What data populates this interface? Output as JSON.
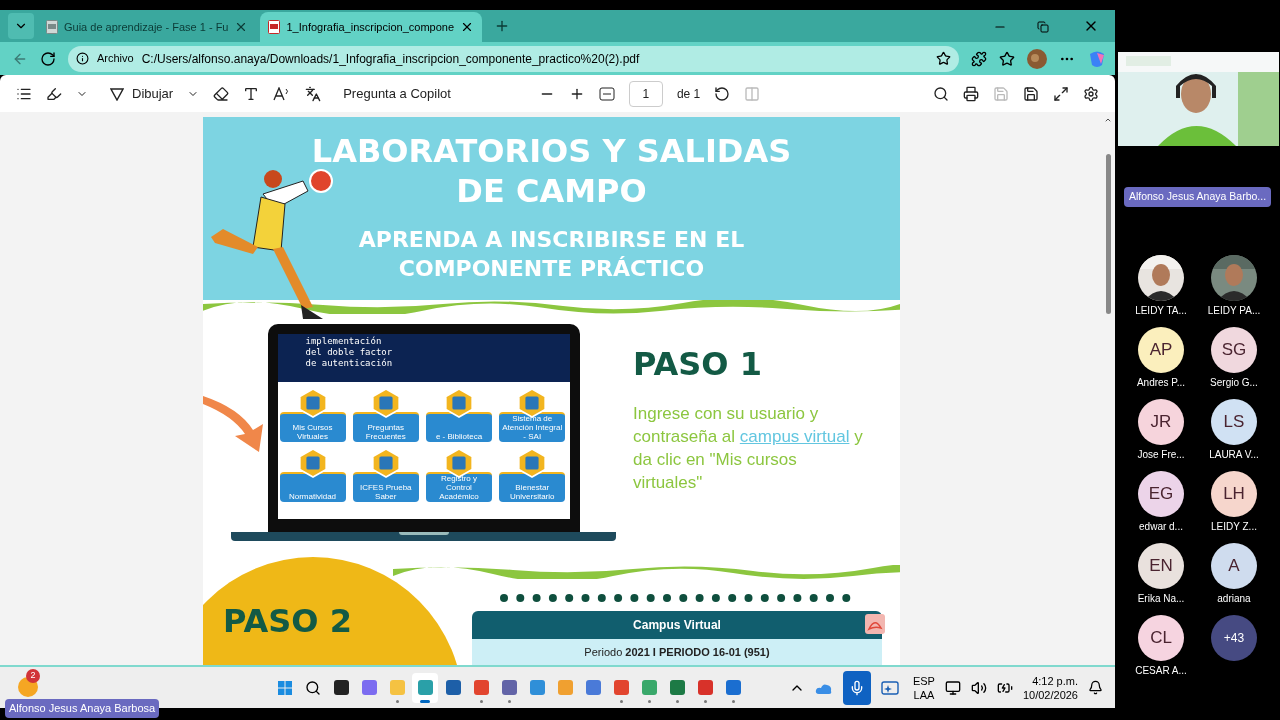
{
  "browser": {
    "tabs": [
      {
        "title": "Guia de aprendizaje - Fase 1 - Fu",
        "selected": false
      },
      {
        "title": "1_Infografia_inscripcion_compone",
        "selected": true
      }
    ],
    "address": {
      "prefix": "Archivo",
      "url": "C:/Users/alfonso.anaya/Downloads/1_Infografia_inscripcion_componente_practico%20(2).pdf"
    }
  },
  "pdf_toolbar": {
    "draw_label": "Dibujar",
    "copilot": "Pregunta a Copilot",
    "page": "1",
    "page_total": "de 1"
  },
  "document": {
    "title_lines": [
      "LABORATORIOS Y SALIDAS",
      "DE CAMPO"
    ],
    "subtitle_lines": [
      "APRENDA A INSCRIBIRSE EN EL",
      "COMPONENTE PRÁCTICO"
    ],
    "laptop": {
      "banner_lines": [
        "implementación",
        "del doble factor",
        "de autenticación"
      ],
      "tiles": [
        "Mis Cursos Virtuales",
        "Preguntas Frecuentes",
        "e - Biblioteca",
        "Sistema de Atención Integral - SAI",
        "Normatividad",
        "ICFES Prueba Saber",
        "Registro y Control Académico",
        "Bienestar Universitario"
      ]
    },
    "step1": {
      "heading": "PASO 1",
      "text_before": "Ingrese con su usuario y contraseña al",
      "link": "campus virtual",
      "text_after": "y da clic en \"Mis cursos virtuales\""
    },
    "step2": {
      "heading": "PASO 2",
      "panel_title": "Campus Virtual",
      "period": "Periodo **2021 I PERIODO 16-01 (951)**"
    }
  },
  "meeting": {
    "presenter_label": "Alfonso Jesus Anaya Barbo...",
    "participants": [
      {
        "name": "LEIDY TA..."
      },
      {
        "name": "LEIDY PA..."
      },
      {
        "kind": "initials",
        "initials": "AP",
        "name": "Andres P...",
        "color": "#fbefbd"
      },
      {
        "kind": "initials",
        "initials": "SG",
        "name": "Sergio G...",
        "color": "#f0d8de"
      },
      {
        "kind": "initials",
        "initials": "JR",
        "name": "Jose Fre...",
        "color": "#f6d4dc"
      },
      {
        "kind": "initials",
        "initials": "LS",
        "name": "LAURA V...",
        "color": "#d0e1f3"
      },
      {
        "kind": "initials",
        "initials": "EG",
        "name": "edwar d...",
        "color": "#ecd4e9"
      },
      {
        "kind": "initials",
        "initials": "LH",
        "name": "LEIDY Z...",
        "color": "#f6d6cc"
      },
      {
        "kind": "initials",
        "initials": "EN",
        "name": "Erika Na...",
        "color": "#e9e1dd"
      },
      {
        "kind": "initials",
        "initials": "A",
        "name": "adriana",
        "color": "#cfdcee"
      },
      {
        "kind": "initials",
        "initials": "CL",
        "name": "CESAR A...",
        "color": "#f6d4e0"
      }
    ],
    "overflow": "+43",
    "self_label": "Alfonso Jesus Anaya Barbosa"
  },
  "taskbar": {
    "notification_count": "2",
    "language": [
      "ESP",
      "LAA"
    ],
    "time": "4:12 p.m.",
    "date": "10/02/2026",
    "mic_on": true
  }
}
